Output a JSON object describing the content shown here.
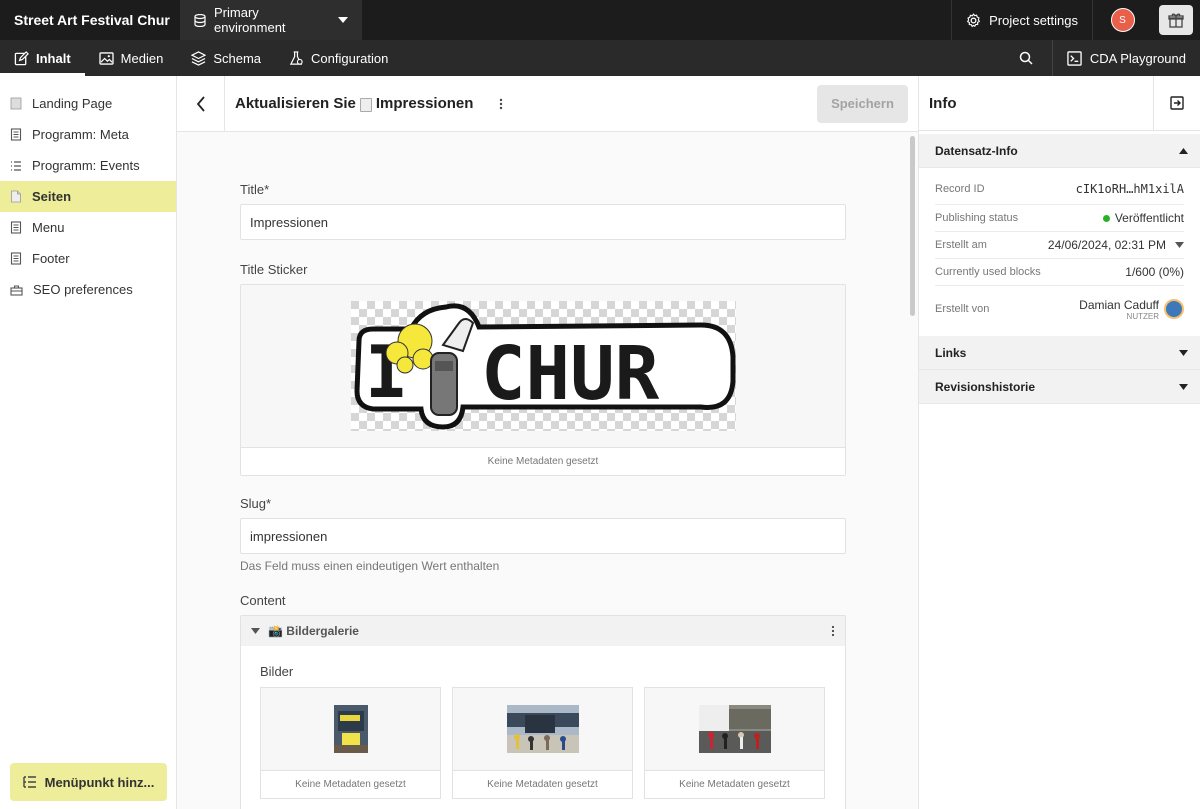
{
  "topbar": {
    "brand": "Street Art Festival Chur",
    "environment": "Primary environment",
    "project_settings": "Project settings",
    "avatar_initial": "S"
  },
  "nav": {
    "tabs": [
      {
        "label": "Inhalt",
        "icon": "edit-icon",
        "active": true
      },
      {
        "label": "Medien",
        "icon": "image-icon"
      },
      {
        "label": "Schema",
        "icon": "layers-icon"
      },
      {
        "label": "Configuration",
        "icon": "settings-flask-icon"
      }
    ],
    "cda": "CDA Playground"
  },
  "sidebar": {
    "items": [
      {
        "label": "Landing Page",
        "icon": "page-icon"
      },
      {
        "label": "Programm: Meta",
        "icon": "document-icon"
      },
      {
        "label": "Programm: Events",
        "icon": "list-icon"
      },
      {
        "label": "Seiten",
        "icon": "page-icon",
        "active": true
      },
      {
        "label": "Menu",
        "icon": "document-icon"
      },
      {
        "label": "Footer",
        "icon": "document-icon"
      },
      {
        "label": "SEO preferences",
        "icon": "toolbox-icon"
      }
    ],
    "add_menu_label": "Menüpunkt hinz..."
  },
  "main": {
    "header_prefix": "Aktualisieren Sie",
    "header_record": "Impressionen",
    "save_label": "Speichern",
    "fields": {
      "title_label": "Title*",
      "title_value": "Impressionen",
      "sticker_label": "Title Sticker",
      "sticker_caption": "Keine Metadaten gesetzt",
      "slug_label": "Slug*",
      "slug_value": "impressionen",
      "slug_hint": "Das Feld muss einen eindeutigen Wert enthalten",
      "content_label": "Content"
    },
    "block": {
      "title": "📸 Bildergalerie",
      "images_label": "Bilder",
      "thumb_captions": [
        "Keine Metadaten gesetzt",
        "Keine Metadaten gesetzt",
        "Keine Metadaten gesetzt"
      ]
    }
  },
  "sticker_text": {
    "left": "I",
    "right": "CHUR"
  },
  "info": {
    "title": "Info",
    "record_section": "Datensatz-Info",
    "rows": {
      "record_id_label": "Record ID",
      "record_id_value": "cIK1oRH…hM1xilA",
      "status_label": "Publishing status",
      "status_value": "Veröffentlicht",
      "created_label": "Erstellt am",
      "created_value": "24/06/2024, 02:31 PM",
      "blocks_label": "Currently used blocks",
      "blocks_value": "1/600 (0%)",
      "creator_label": "Erstellt von",
      "creator_name": "Damian Caduff",
      "creator_role": "NUTZER"
    },
    "links_section": "Links",
    "revisions_section": "Revisionshistorie"
  },
  "colors": {
    "topbar": "#1c1c1c",
    "accent": "#eded9a",
    "status_green": "#27b327",
    "avatar": "#e8604a"
  }
}
